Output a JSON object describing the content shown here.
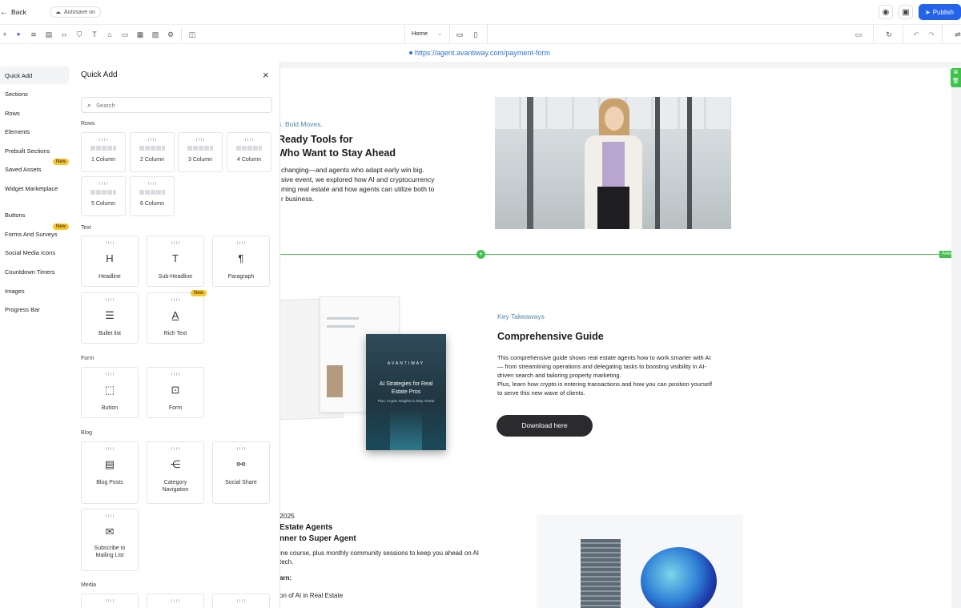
{
  "topbar": {
    "back_label": "Back",
    "autosave_label": "Autosave on",
    "publish_label": "Publish"
  },
  "toolbar": {
    "page_select": "Home"
  },
  "url": {
    "text": "https://agent.avantiway.com/payment-form"
  },
  "sidenav": {
    "items": [
      {
        "label": "Quick Add"
      },
      {
        "label": "Sections"
      },
      {
        "label": "Rows"
      },
      {
        "label": "Elements"
      },
      {
        "label": "Prebuilt Sections"
      },
      {
        "label": "Saved Assets",
        "badge": "New"
      },
      {
        "label": "Widget Marketplace"
      },
      {
        "label": "Buttons"
      },
      {
        "label": "Forms And Surveys",
        "badge": "New"
      },
      {
        "label": "Social Media Icons"
      },
      {
        "label": "Countdown Timers"
      },
      {
        "label": "Images"
      },
      {
        "label": "Progress Bar"
      }
    ]
  },
  "panel": {
    "title": "Quick Add",
    "search_placeholder": "Search",
    "rows_label": "Rows",
    "rows": [
      "1 Column",
      "2 Column",
      "3 Column",
      "4 Column",
      "5 Column",
      "6 Column"
    ],
    "text_label": "Text",
    "text_items": [
      {
        "label": "Headline"
      },
      {
        "label": "Sub-Headline"
      },
      {
        "label": "Paragraph"
      },
      {
        "label": "Bullet list"
      },
      {
        "label": "Rich Text",
        "badge": "New"
      }
    ],
    "form_label": "Form",
    "form_items": [
      {
        "label": "Button"
      },
      {
        "label": "Form"
      }
    ],
    "blog_label": "Blog",
    "blog_items": [
      {
        "label": "Blog Posts"
      },
      {
        "label": "Category Navigation"
      },
      {
        "label": "Social Share"
      },
      {
        "label": "Subscribe to Mailing List"
      }
    ],
    "media_label": "Media"
  },
  "canvas": {
    "hero_kicker": "s. Bold Moves.",
    "hero_title_1": "Ready Tools for",
    "hero_title_2": "Who Want to Stay Ahead",
    "hero_body_1": "changing—and agents who adapt early win big.",
    "hero_body_2": "sive event, we explored how AI and cryptocurrency",
    "hero_body_3": "ming real estate and how agents can utilize both to",
    "hero_body_4": "r business.",
    "row_tag": "Avexa",
    "book_brand": "AVANTIWAY",
    "book_title": "AI Strategies for Real Estate Pros",
    "book_subtitle": "Plus: Crypto Insights to Stay Ahead",
    "kicker": "Key Takeaways",
    "title": "Comprehensive Guide",
    "body_1": "This comprehensive guide shows real estate agents how to work smarter with AI",
    "body_2": "— from streamlining operations and delegating tasks to boosting visibility in AI-",
    "body_3": "driven search and tailoring property marketing.",
    "body_4": "Plus, learn how crypto is entering transactions and how you can position yourself",
    "body_5": "to serve this new wave of clients.",
    "cta": "Download here",
    "year": "2025",
    "course_title_1": "Estate Agents",
    "course_title_2": "nner to Super Agent",
    "course_body_1": "ine course, plus monthly community sessions to keep you ahead on AI",
    "course_body_2": "tech.",
    "course_sub": "arn:",
    "course_item": "on of AI in Real Estate"
  }
}
